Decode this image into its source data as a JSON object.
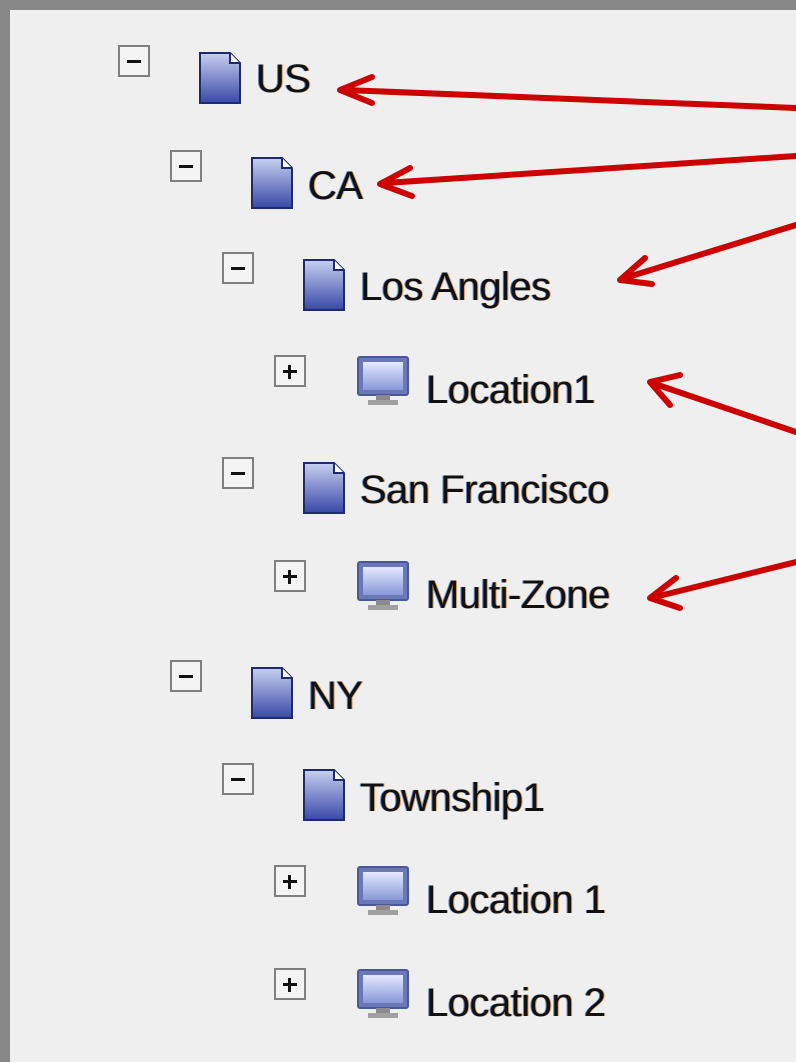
{
  "tree": {
    "nodes": [
      {
        "label": "US",
        "type": "folder",
        "state": "expanded",
        "depth": 0
      },
      {
        "label": "CA",
        "type": "folder",
        "state": "expanded",
        "depth": 1
      },
      {
        "label": "Los Angles",
        "type": "folder",
        "state": "expanded",
        "depth": 2
      },
      {
        "label": "Location1",
        "type": "monitor",
        "state": "collapsed",
        "depth": 3
      },
      {
        "label": "San Francisco",
        "type": "folder",
        "state": "expanded",
        "depth": 2
      },
      {
        "label": "Multi-Zone",
        "type": "monitor",
        "state": "collapsed",
        "depth": 3
      },
      {
        "label": "NY",
        "type": "folder",
        "state": "expanded",
        "depth": 1
      },
      {
        "label": "Township1",
        "type": "folder",
        "state": "expanded",
        "depth": 2
      },
      {
        "label": "Location 1",
        "type": "monitor",
        "state": "collapsed",
        "depth": 3
      },
      {
        "label": "Location 2",
        "type": "monitor",
        "state": "collapsed",
        "depth": 3
      }
    ]
  },
  "colors": {
    "arrow": "#cc0000",
    "panel_bg": "#efefef",
    "frame": "#888888"
  },
  "icons": {
    "folder": "document-folder-icon",
    "monitor": "monitor-icon",
    "expanded": "minus-toggle-icon",
    "collapsed": "plus-toggle-icon"
  }
}
